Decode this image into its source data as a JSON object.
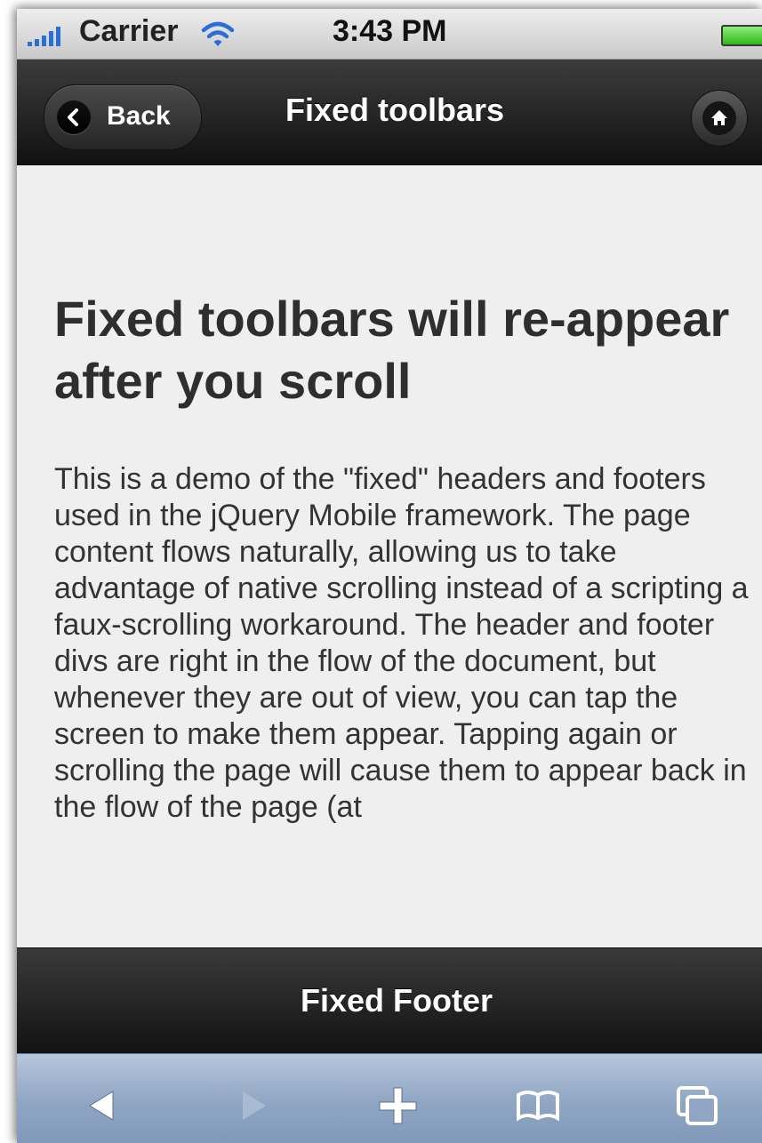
{
  "status_bar": {
    "carrier": "Carrier",
    "time": "3:43 PM",
    "icons": [
      "signal-icon",
      "wifi-icon",
      "battery-icon"
    ]
  },
  "header": {
    "back_label": "Back",
    "title": "Fixed toolbars",
    "home_icon": "home-icon"
  },
  "content": {
    "heading": "Fixed toolbars will re-appear after you scroll",
    "paragraph": "This is a demo of the \"fixed\" headers and footers used in the jQuery Mobile framework. The page content flows naturally, allowing us to take advantage of native scrolling instead of a scripting a faux-scrolling workaround. The header and footer divs are right in the flow of the document, but whenever they are out of view, you can tap the screen to make them appear. Tapping again or scrolling the page will cause them to appear back in the flow of the page (at"
  },
  "footer": {
    "title": "Fixed Footer"
  },
  "browser_toolbar": {
    "icons": [
      "back-arrow-icon",
      "forward-arrow-icon",
      "add-icon",
      "bookmarks-icon",
      "pages-icon"
    ]
  },
  "colors": {
    "header_bg": "#1b1b1b",
    "content_bg": "#efefef",
    "toolbar_bg": "#8fa5c3",
    "text": "#333333"
  }
}
